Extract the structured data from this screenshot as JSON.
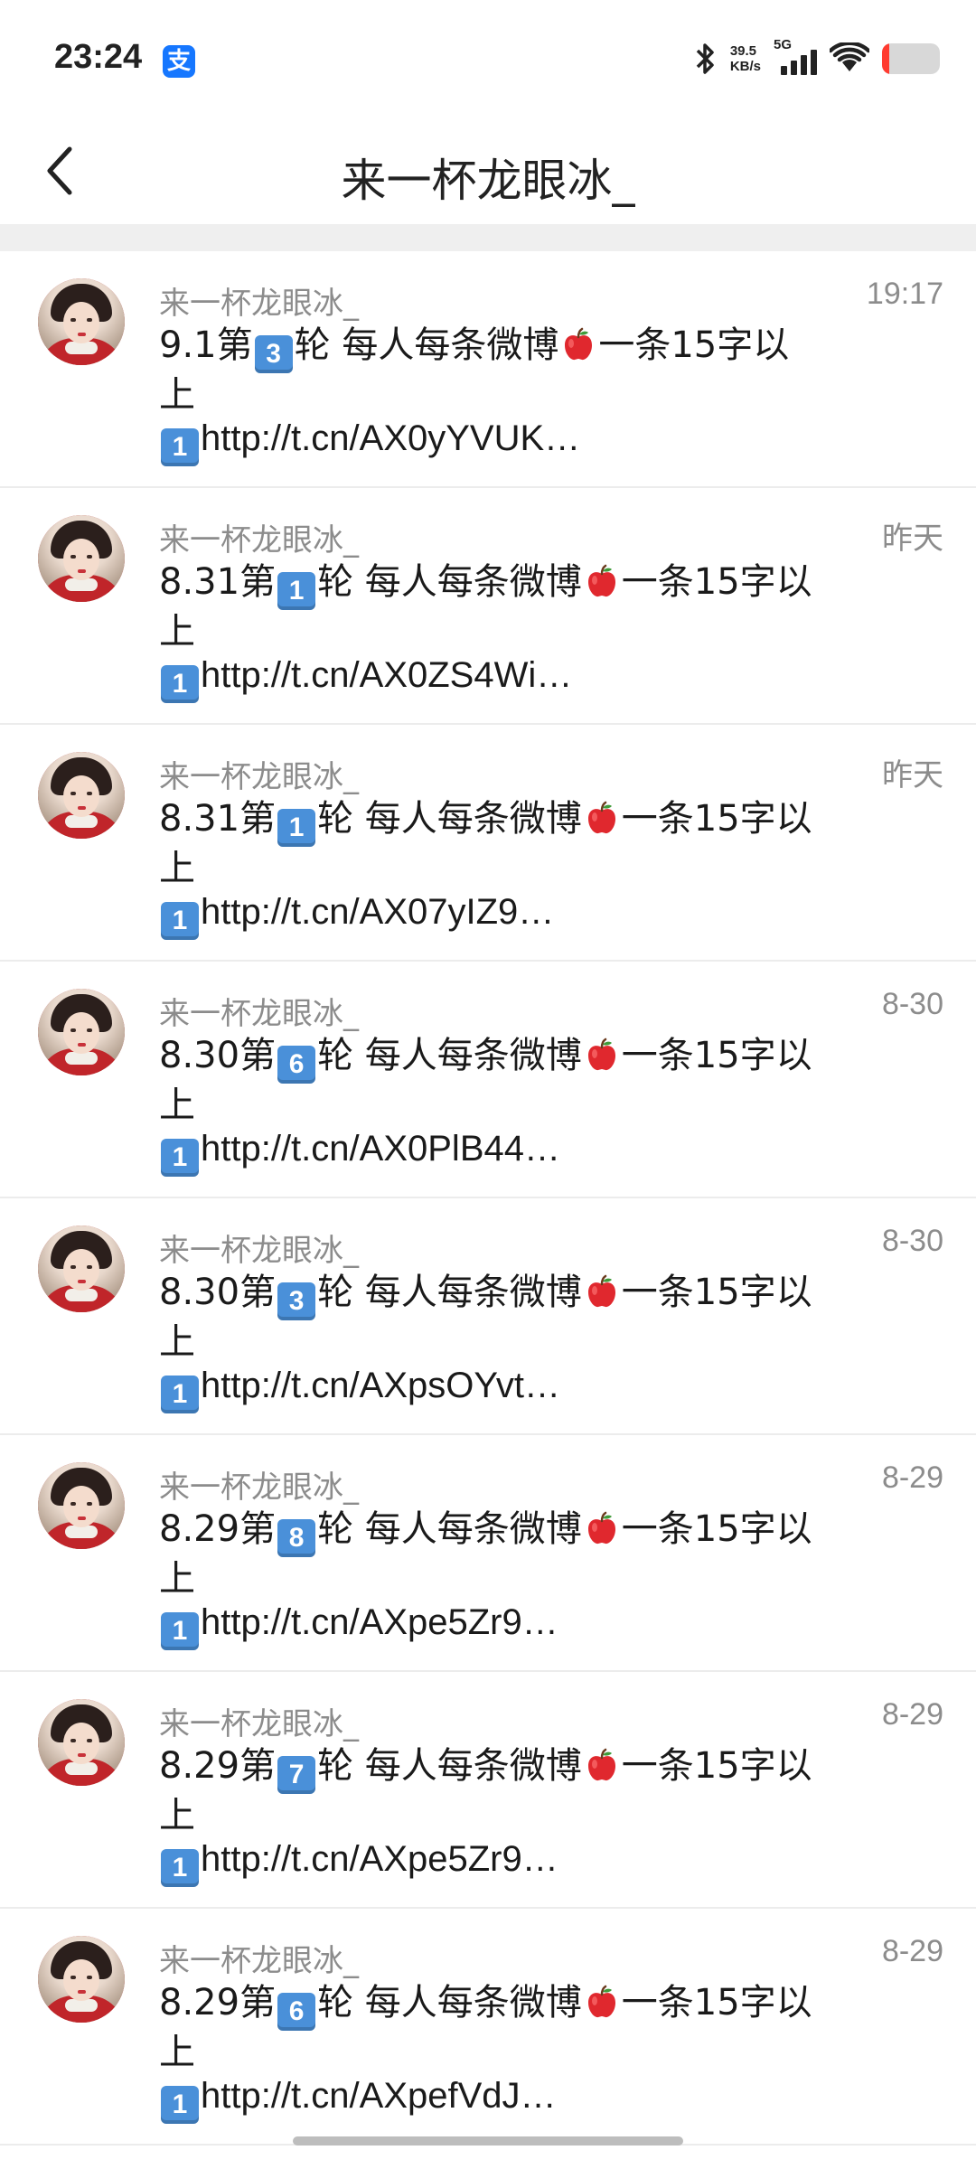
{
  "status_bar": {
    "time": "23:24",
    "app_badge": "支",
    "speed_value": "39.5",
    "speed_unit": "KB/s",
    "network": "5G",
    "battery_level": 0.12
  },
  "nav": {
    "title": "来一杯龙眼冰_",
    "back_icon": "chevron-left-icon"
  },
  "messages": [
    {
      "sender": "来一杯龙眼冰_",
      "time": "19:17",
      "prefix": "9.1第",
      "round": "3",
      "middle": "轮 每人每条微博",
      "suffix": "一条15字以",
      "line2": "上",
      "link_num": "1",
      "link": "http://t.cn/AX0yYVUK…"
    },
    {
      "sender": "来一杯龙眼冰_",
      "time": "昨天",
      "prefix": "8.31第",
      "round": "1",
      "middle": "轮 每人每条微博",
      "suffix": "一条15字以",
      "line2": "上",
      "link_num": "1",
      "link": "http://t.cn/AX0ZS4Wi…"
    },
    {
      "sender": "来一杯龙眼冰_",
      "time": "昨天",
      "prefix": "8.31第",
      "round": "1",
      "middle": "轮 每人每条微博",
      "suffix": "一条15字以",
      "line2": "上",
      "link_num": "1",
      "link": "http://t.cn/AX07yIZ9…"
    },
    {
      "sender": "来一杯龙眼冰_",
      "time": "8-30",
      "prefix": "8.30第",
      "round": "6",
      "middle": "轮 每人每条微博",
      "suffix": "一条15字以",
      "line2": "上",
      "link_num": "1",
      "link": "http://t.cn/AX0PlB44…"
    },
    {
      "sender": "来一杯龙眼冰_",
      "time": "8-30",
      "prefix": "8.30第",
      "round": "3",
      "middle": "轮 每人每条微博",
      "suffix": "一条15字以",
      "line2": "上",
      "link_num": "1",
      "link": "http://t.cn/AXpsOYvt…"
    },
    {
      "sender": "来一杯龙眼冰_",
      "time": "8-29",
      "prefix": "8.29第",
      "round": "8",
      "middle": "轮 每人每条微博",
      "suffix": "一条15字以",
      "line2": "上",
      "link_num": "1",
      "link": "http://t.cn/AXpe5Zr9…"
    },
    {
      "sender": "来一杯龙眼冰_",
      "time": "8-29",
      "prefix": "8.29第",
      "round": "7",
      "middle": "轮 每人每条微博",
      "suffix": "一条15字以",
      "line2": "上",
      "link_num": "1",
      "link": "http://t.cn/AXpe5Zr9…"
    },
    {
      "sender": "来一杯龙眼冰_",
      "time": "8-29",
      "prefix": "8.29第",
      "round": "6",
      "middle": "轮 每人每条微博",
      "suffix": "一条15字以",
      "line2": "上",
      "link_num": "1",
      "link": "http://t.cn/AXpefVdJ…"
    }
  ],
  "colors": {
    "keycap": "#4a90d9",
    "secondary_text": "#8c8c8c",
    "battery_low": "#ff3b30",
    "alipay_blue": "#1677ff"
  }
}
